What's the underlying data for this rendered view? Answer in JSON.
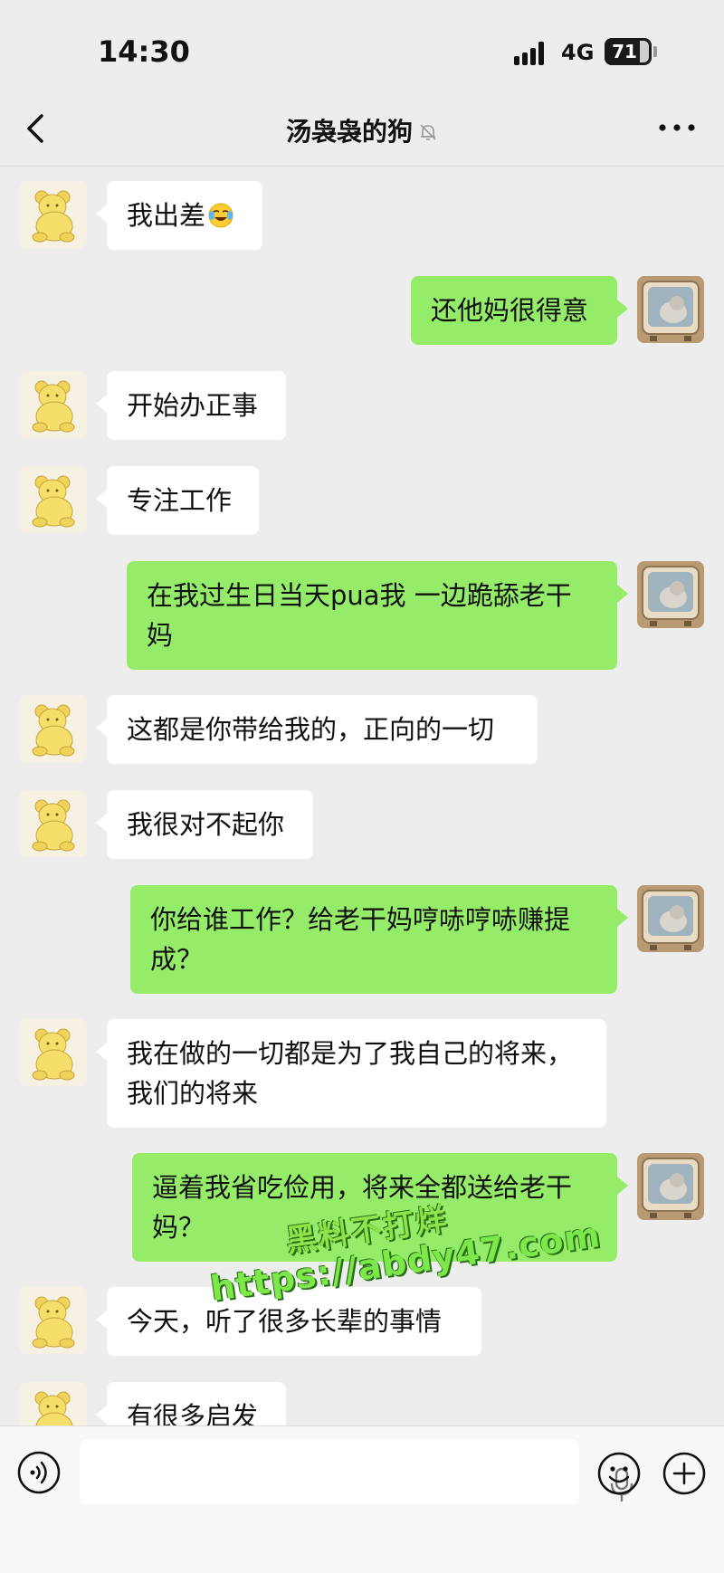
{
  "status_bar": {
    "time": "14:30",
    "network": "4G",
    "battery": "71",
    "battery_level": 0.71
  },
  "nav": {
    "title": "汤袅袅的狗"
  },
  "messages": [
    {
      "side": "left",
      "text": "我出差",
      "emoji": "face-with-tears-of-joy-icon"
    },
    {
      "side": "right",
      "text": "还他妈很得意"
    },
    {
      "side": "left",
      "text": "开始办正事"
    },
    {
      "side": "left",
      "text": "专注工作"
    },
    {
      "side": "right",
      "text": "在我过生日当天pua我 一边跪舔老干妈"
    },
    {
      "side": "left",
      "text": "这都是你带给我的，正向的一切"
    },
    {
      "side": "left",
      "text": "我很对不起你"
    },
    {
      "side": "right",
      "text": "你给谁工作？给老干妈哼哧哼哧赚提成？"
    },
    {
      "side": "left",
      "text": "我在做的一切都是为了我自己的将来，我们的将来"
    },
    {
      "side": "right",
      "text": "逼着我省吃俭用，将来全都送给老干妈？"
    },
    {
      "side": "left",
      "text": "今天，听了很多长辈的事情"
    },
    {
      "side": "left",
      "text": "有很多启发"
    }
  ],
  "watermark": {
    "line1": "黑料不打烊",
    "line2": "https://abdy47.com"
  },
  "colors": {
    "background": "#ededed",
    "bubble_self": "#95ec69",
    "bubble_other": "#ffffff"
  }
}
